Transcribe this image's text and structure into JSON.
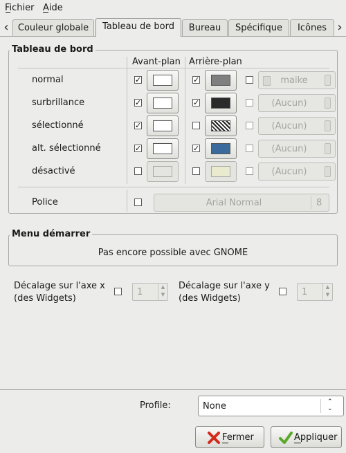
{
  "menubar": {
    "items": [
      {
        "label": "Fichier"
      },
      {
        "label": "Aide"
      }
    ]
  },
  "tabs": {
    "items": [
      {
        "label": "Couleur globale"
      },
      {
        "label": "Tableau de bord",
        "active": true
      },
      {
        "label": "Bureau"
      },
      {
        "label": "Spécifique"
      },
      {
        "label": "Icônes"
      }
    ]
  },
  "panel": {
    "title": "Tableau de bord",
    "fg_header": "Avant-plan",
    "bg_header": "Arrière-plan",
    "rows": [
      {
        "label": "normal",
        "fg_checked": true,
        "fg_color": "#ffffff",
        "bg_checked": true,
        "bg_color": "#7f7f7f",
        "extra_checked": false,
        "combo": "maike",
        "enabled": true
      },
      {
        "label": "surbrillance",
        "fg_checked": true,
        "fg_color": "#ffffff",
        "bg_checked": true,
        "bg_color": "#2a2a2a",
        "extra_checked": false,
        "combo": "(Aucun)",
        "enabled": true
      },
      {
        "label": "sélectionné",
        "fg_checked": true,
        "fg_color": "#ffffff",
        "bg_checked": false,
        "bg_color": "pattern",
        "extra_checked": false,
        "combo": "(Aucun)",
        "enabled": true
      },
      {
        "label": "alt. sélectionné",
        "fg_checked": true,
        "fg_color": "#ffffff",
        "bg_checked": true,
        "bg_color": "#3a6b9c",
        "extra_checked": false,
        "combo": "(Aucun)",
        "enabled": true
      },
      {
        "label": "désactivé",
        "fg_checked": false,
        "fg_color": "#e4e4e0",
        "bg_checked": false,
        "bg_color": "#eaeace",
        "extra_checked": false,
        "combo": "(Aucun)",
        "enabled": false
      }
    ],
    "font_label": "Police",
    "font_name": "Arial Normal",
    "font_size": "8"
  },
  "start_menu": {
    "title": "Menu démarrer",
    "message": "Pas encore possible avec GNOME"
  },
  "offsets": {
    "x_label_line1": "Décalage sur l'axe x",
    "x_label_line2": "(des Widgets)",
    "x_value": "1",
    "y_label_line1": "Décalage sur l'axe y",
    "y_label_line2": "(des Widgets)",
    "y_value": "1"
  },
  "profile": {
    "label": "Profile:",
    "value": "None"
  },
  "buttons": {
    "close": "Fermer",
    "apply": "Appliquer"
  },
  "colors": {
    "close_icon": "#d42a1a",
    "apply_icon": "#5aa82a"
  }
}
